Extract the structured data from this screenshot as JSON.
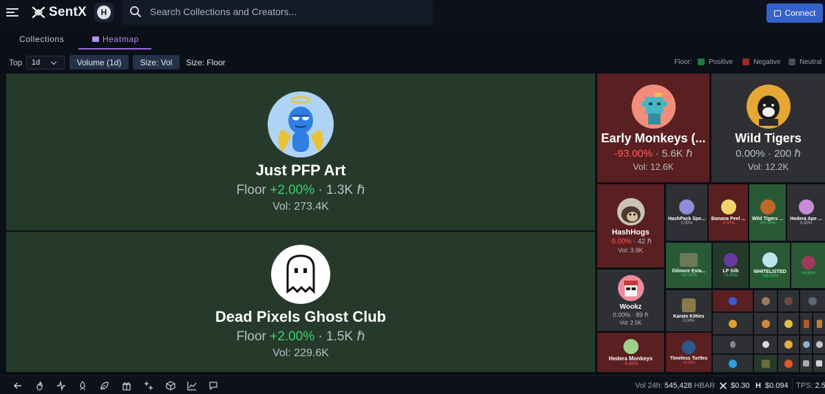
{
  "header": {
    "logo_text": "SentX",
    "hbar_badge": "H",
    "search_placeholder": "Search Collections and Creators...",
    "connect_label": "Connect"
  },
  "tabs": [
    {
      "label": "Collections",
      "active": false
    },
    {
      "label": "Heatmap",
      "active": true
    }
  ],
  "controls": {
    "top_label": "Top",
    "period_value": "1d",
    "volume_button": "Volume (1d)",
    "size_vol_button": "Size: Vol",
    "size_floor_button": "Size: Floor"
  },
  "legend": {
    "title": "Floor:",
    "items": [
      {
        "label": "Positive",
        "color": "#1e7a3a"
      },
      {
        "label": "Negative",
        "color": "#9b2a2a"
      },
      {
        "label": "Neutral",
        "color": "#4a4c50"
      }
    ]
  },
  "colors": {
    "positive_tile": "#263a2c",
    "negative_tile": "#5a1f20",
    "neutral_tile": "#2f3033",
    "up_text": "#3dd36b",
    "down_text": "#ff5d5d",
    "accent": "#9c6ce3"
  },
  "tiles": {
    "just_pfp": {
      "name": "Just PFP Art",
      "floor_prefix": "Floor",
      "change": "+2.00%",
      "floor": "1.3K",
      "currency": "ℏ",
      "vol": "Vol: 273.4K"
    },
    "dead_pixels": {
      "name": "Dead Pixels Ghost Club",
      "floor_prefix": "Floor",
      "change": "+2.00%",
      "floor": "1.5K",
      "currency": "ℏ",
      "vol": "Vol: 229.6K"
    },
    "early_monkeys": {
      "name": "Early Monkeys (...",
      "change": "-93.00%",
      "floor": "5.6K",
      "currency": "ℏ",
      "vol": "Vol: 12.6K"
    },
    "wild_tigers": {
      "name": "Wild Tigers",
      "change": "0.00%",
      "floor": "200",
      "currency": "ℏ",
      "vol": "Vol: 12.2K"
    },
    "hashhogs": {
      "name": "HashHogs",
      "change": "-5.00%",
      "floor": "42",
      "currency": "ℏ",
      "vol": "Vol: 3.9K"
    },
    "wookz": {
      "name": "Wookz",
      "change": "0.00%",
      "floor": "89",
      "currency": "ℏ",
      "vol": "Vol: 2.5K"
    },
    "hedera_monkeys": {
      "name": "Hedera Monkeys",
      "change": "-4.00%"
    },
    "hashpack": {
      "name": "HashPack Spe...",
      "change": "0.00%"
    },
    "banana_peel": {
      "name": "Banana Peel ...",
      "change": "-5.00%"
    },
    "wild_tigers_small": {
      "name": "Wild Tigers ...",
      "change": "+67.00%"
    },
    "hedera_ape": {
      "name": "Hedera Ape ...",
      "change": "0.00%"
    },
    "gilmore": {
      "name": "Gilmore Esta...",
      "change": "+87.00%"
    },
    "lp_silk": {
      "name": "LP Silk",
      "change": "+3.00%"
    },
    "whitelisted": {
      "name": "WHITELISTED",
      "change": "+88.00%"
    },
    "small_pos": {
      "change": "+9.00%"
    },
    "karate_kitties": {
      "name": "Karate Kitties",
      "change": "0.00%"
    },
    "timeless_turtles": {
      "name": "Timeless Turtles",
      "change": "-4.00%"
    }
  },
  "footer": {
    "vol_label": "Vol 24h:",
    "vol_value": "545,428",
    "vol_unit": "HBAR",
    "sentx_price": "$0.30",
    "hbar_price": "$0.094",
    "tps_label": "TPS:",
    "tps_value": "2.5",
    "icons": [
      "back-arrow-icon",
      "flame-icon",
      "activity-icon",
      "rocket-icon",
      "leaf-icon",
      "gift-icon",
      "sparkles-icon",
      "cube-icon",
      "chart-icon",
      "chat-icon"
    ]
  }
}
